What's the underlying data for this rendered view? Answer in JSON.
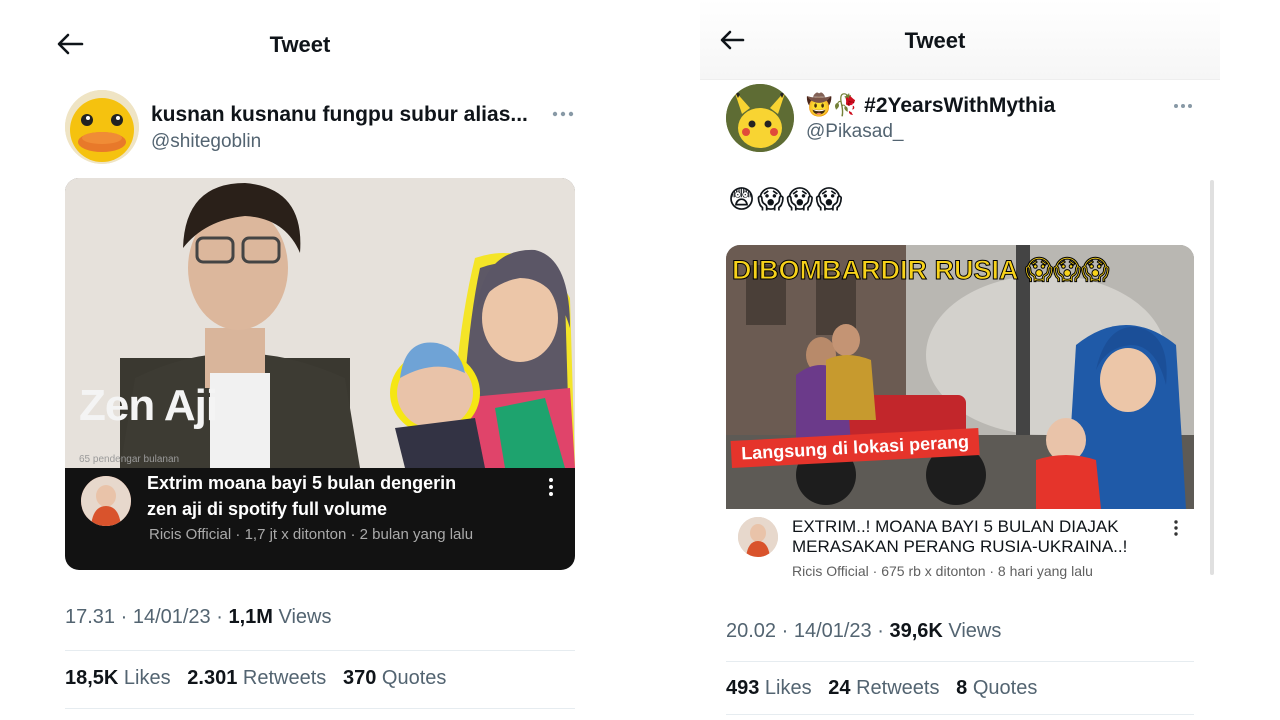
{
  "left": {
    "header_title": "Tweet",
    "author_name": "kusnan kusnanu fungpu subur alias...",
    "author_handle": "@shitegoblin",
    "media": {
      "overlay_name": "Zen Aji",
      "listeners": "65 pendengar bulanan",
      "video_title_line1": "Extrim moana bayi 5 bulan dengerin",
      "video_title_line2": "zen aji di spotify full volume",
      "video_meta": "Ricis Official · 1,7 jt x ditonton · 2 bulan yang lalu"
    },
    "time": "17.31 · 14/01/23 · ",
    "views_count": "1,1M",
    "views_label": " Views",
    "likes_count": "18,5K",
    "likes_label": " Likes",
    "retweets_count": "2.301",
    "retweets_label": " Retweets",
    "quotes_count": "370",
    "quotes_label": " Quotes"
  },
  "right": {
    "header_title": "Tweet",
    "author_emoji": "🤠🥀",
    "author_name": "#2YearsWithMythia",
    "author_handle": "@Pikasad_",
    "tweet_text": "😨😱😱😱",
    "media": {
      "headline": "DIBOMBARDIR RUSIA 😱😱😱",
      "banner": "Langsung di lokasi perang",
      "video_title_line1": "EXTRIM..! MOANA BAYI 5 BULAN DIAJAK",
      "video_title_line2": "MERASAKAN PERANG RUSIA-UKRAINA..!",
      "video_meta": "Ricis Official · 675 rb x ditonton · 8 hari yang lalu"
    },
    "time": "20.02 · 14/01/23 · ",
    "views_count": "39,6K",
    "views_label": " Views",
    "likes_count": "493",
    "likes_label": " Likes",
    "retweets_count": "24",
    "retweets_label": " Retweets",
    "quotes_count": "8",
    "quotes_label": " Quotes"
  },
  "colors": {
    "text": "#0f1419",
    "secondary": "#536471",
    "rule": "#e6ecf0",
    "video_bg": "#121212",
    "headline_yellow": "#f7d21b",
    "banner_red": "#e5342b"
  },
  "icons": [
    "back-arrow-icon",
    "more-dots-icon",
    "video-more-icon",
    "duck-avatar",
    "pikachu-avatar"
  ]
}
